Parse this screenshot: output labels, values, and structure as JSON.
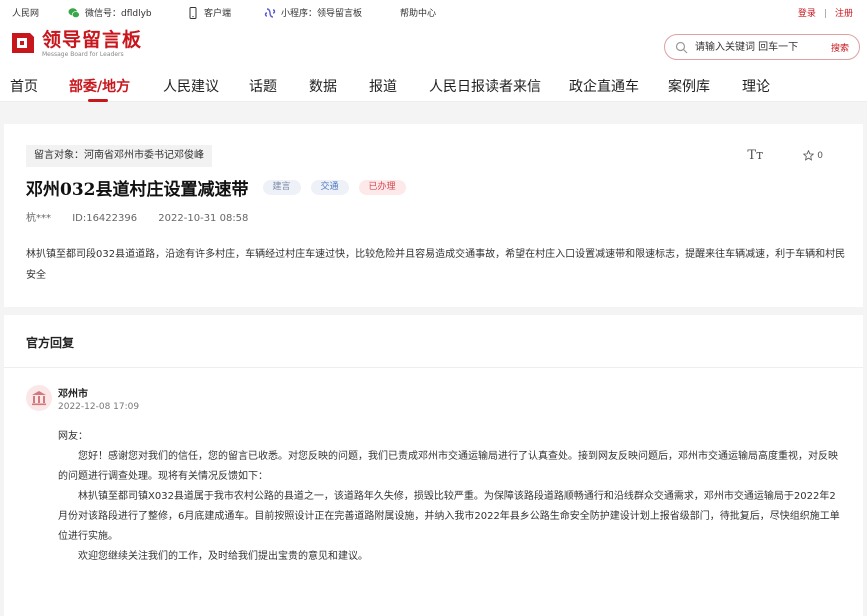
{
  "topbar": {
    "site": "人民网",
    "wechat": "微信号：dfldlyb",
    "client": "客户端",
    "miniprogram": "小程序：领导留言板",
    "help": "帮助中心",
    "login": "登录",
    "sep": "|",
    "register": "注册"
  },
  "logo": {
    "cn": "领导留言板",
    "en": "Message Board for Leaders"
  },
  "search": {
    "placeholder": "请输入关键词 回车一下",
    "button": "搜索"
  },
  "nav": {
    "tabs": [
      {
        "label": "首页"
      },
      {
        "label": "部委/地方",
        "active": true
      },
      {
        "label": "人民建议"
      },
      {
        "label": "话题"
      },
      {
        "label": "数据"
      },
      {
        "label": "报道"
      },
      {
        "label": "人民日报读者来信"
      },
      {
        "label": "政企直通车"
      },
      {
        "label": "案例库"
      },
      {
        "label": "理论"
      }
    ]
  },
  "message": {
    "target": "留言对象：河南省邓州市委书记邓俊峰",
    "title": "邓州032县道村庄设置减速带",
    "tags": [
      "建言",
      "交通",
      "已办理"
    ],
    "font_tool": "Tт",
    "favorites": "0",
    "author": "杭***",
    "id": "ID:16422396",
    "date": "2022-10-31 08:58",
    "body": "林扒镇至都司段032县道道路，沿途有许多村庄，车辆经过村庄车速过快，比较危险并且容易造成交通事故，希望在村庄入口设置减速带和限速标志，提醒来往车辆减速，利于车辆和村民安全"
  },
  "reply": {
    "heading": "官方回复",
    "org": "邓州市",
    "date": "2022-12-08 17:09",
    "greeting": "网友：",
    "p1": "您好！感谢您对我们的信任，您的留言已收悉。对您反映的问题，我们已责成邓州市交通运输局进行了认真查处。接到网友反映问题后，邓州市交通运输局高度重视，对反映的问题进行调查处理。现将有关情况反馈如下：",
    "p2": "林扒镇至都司镇X032县道属于我市农村公路的县道之一，该道路年久失修，损毁比较严重。为保障该路段道路顺畅通行和沿线群众交通需求，邓州市交通运输局于2022年2月份对该路段进行了整修，6月底建成通车。目前按照设计正在完善道路附属设施，并纳入我市2022年县乡公路生命安全防护建设计划上报省级部门，待批复后，尽快组织施工单位进行实施。",
    "p3": "欢迎您继续关注我们的工作，及时给我们提出宝贵的意见和建议。"
  },
  "colors": {
    "accent": "#c8161d",
    "tag_blue": "#4a78c2",
    "tag_red": "#d34a52"
  }
}
